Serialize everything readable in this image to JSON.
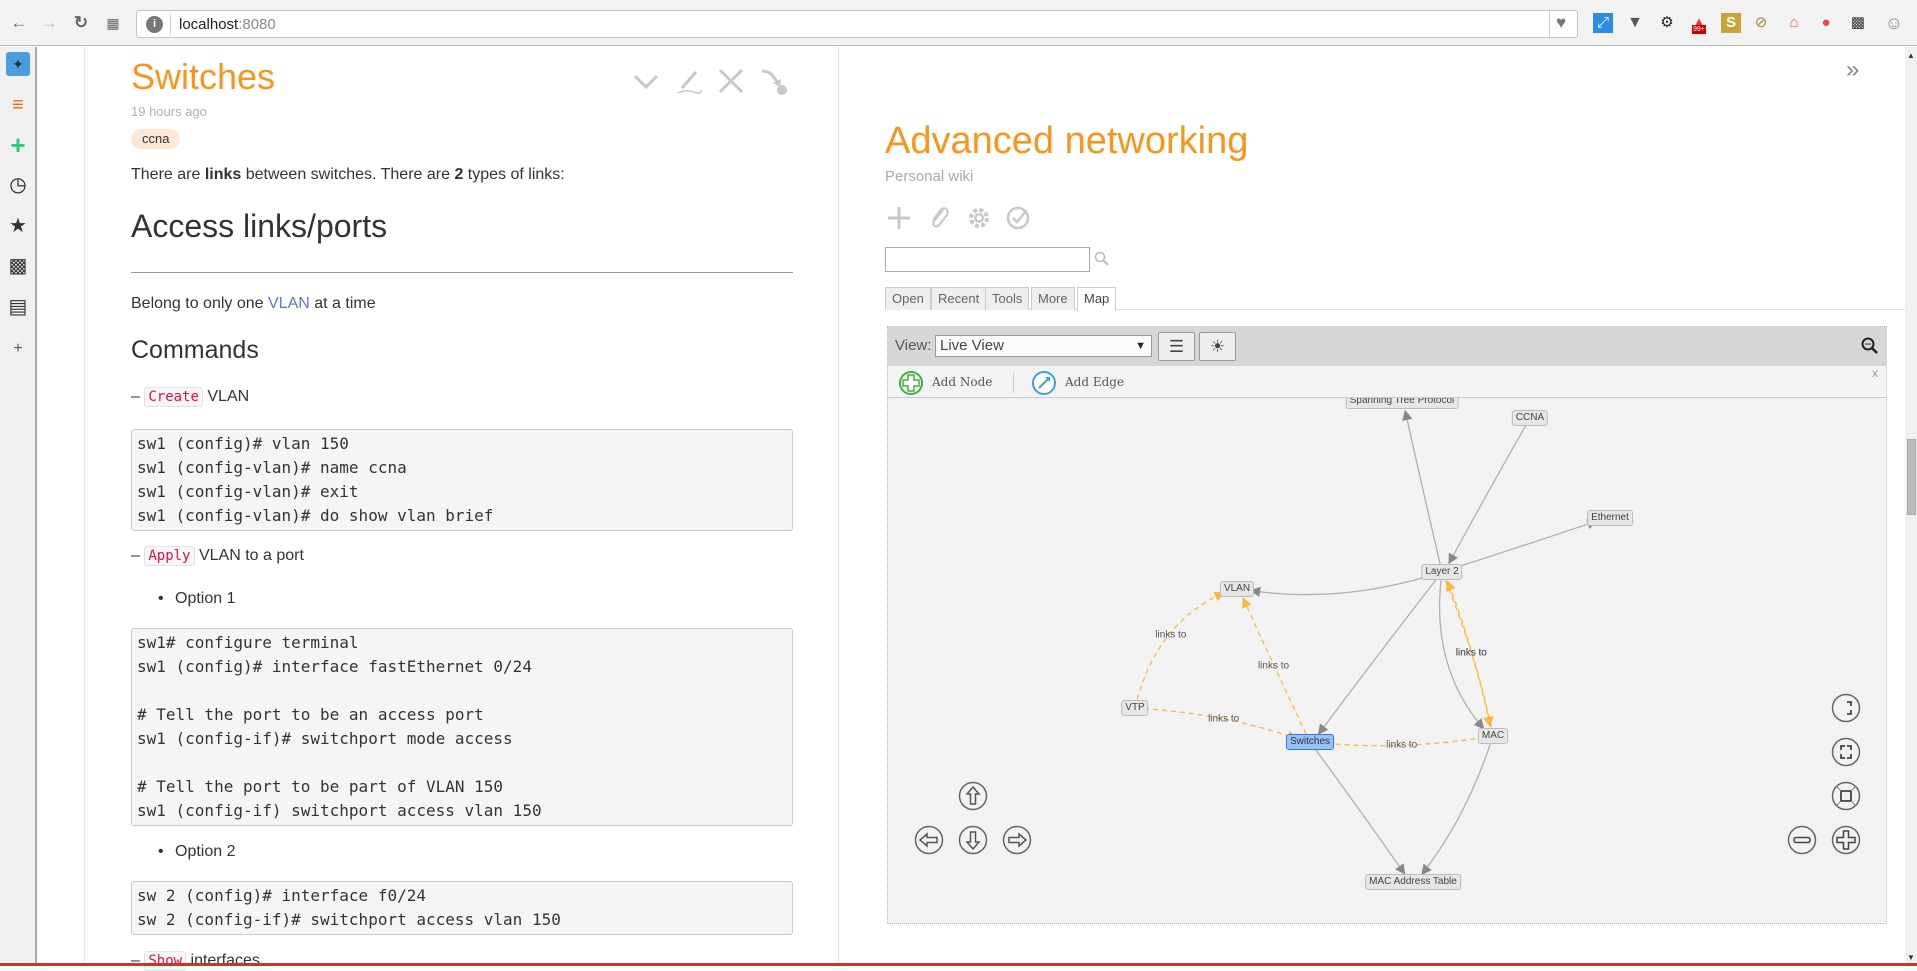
{
  "browser": {
    "url_host": "localhost",
    "url_port": ":8080",
    "extension_icons": [
      "resize-icon",
      "pocket-icon",
      "gear-icon",
      "notification-badge-icon",
      "s-icon",
      "blocked-icon",
      "home-icon",
      "browser-logo-icon",
      "tiles-icon",
      "profile-icon"
    ],
    "badge_text": "99+"
  },
  "sidebar": {
    "icons": [
      "tweetdeck-icon",
      "tasks-icon",
      "add-icon",
      "clock-icon",
      "star-icon",
      "tiles-icon",
      "document-icon",
      "plus-small-icon"
    ]
  },
  "tiddler": {
    "title": "Switches",
    "date": "19 hours ago",
    "tag": "ccna",
    "intro": {
      "t1": "There are ",
      "b1": "links",
      "t2": " between switches. There are ",
      "b2": "2",
      "t3": " types of links:"
    },
    "h_access": "Access links/ports",
    "belong": {
      "t1": "Belong to only one ",
      "link": "VLAN",
      "t2": " at a time"
    },
    "h_commands": "Commands",
    "create_line": {
      "dash": "– ",
      "code": "Create",
      "text": " VLAN"
    },
    "code1": "sw1 (config)# vlan 150\nsw1 (config-vlan)# name ccna\nsw1 (config-vlan)# exit\nsw1 (config-vlan)# do show vlan brief",
    "apply_line": {
      "dash": "– ",
      "code": "Apply",
      "text": " VLAN to a port"
    },
    "option1": "Option 1",
    "code2": "sw1# configure terminal\nsw1 (config)# interface fastEthernet 0/24\n\n# Tell the port to be an access port\nsw1 (config-if)# switchport mode access\n\n# Tell the port to be part of VLAN 150\nsw1 (config-if) switchport access vlan 150",
    "option2": "Option 2",
    "code3": "sw 2 (config)# interface f0/24\nsw 2 (config-if)# switchport access vlan 150",
    "show_line": {
      "dash": "– ",
      "code": "Show",
      "text": " interfaces"
    }
  },
  "site": {
    "title": "Advanced networking",
    "subtitle": "Personal wiki",
    "search_value": "",
    "tabs": [
      "Open",
      "Recent",
      "Tools",
      "More",
      "Map"
    ],
    "active_tab": "Map"
  },
  "map": {
    "view_label": "View:",
    "view_selected": "Live View",
    "add_node": "Add Node",
    "add_edge": "Add Edge",
    "close": "x",
    "nodes": [
      {
        "id": "stp",
        "label": "Spanning Tree Protocol"
      },
      {
        "id": "ccna",
        "label": "CCNA"
      },
      {
        "id": "ethernet",
        "label": "Ethernet"
      },
      {
        "id": "layer2",
        "label": "Layer 2"
      },
      {
        "id": "vlan",
        "label": "VLAN"
      },
      {
        "id": "vtp",
        "label": "VTP"
      },
      {
        "id": "switches",
        "label": "Switches",
        "selected": true
      },
      {
        "id": "mac",
        "label": "MAC"
      },
      {
        "id": "mactable",
        "label": "MAC Address Table"
      }
    ],
    "edges": [
      {
        "from": "layer2",
        "to": "stp",
        "type": "solid"
      },
      {
        "from": "ccna",
        "to": "layer2",
        "type": "solid"
      },
      {
        "from": "layer2",
        "to": "ethernet",
        "type": "solid"
      },
      {
        "from": "layer2",
        "to": "vlan",
        "type": "solid"
      },
      {
        "from": "layer2",
        "to": "switches",
        "type": "solid"
      },
      {
        "from": "layer2",
        "to": "mac",
        "type": "solid"
      },
      {
        "from": "switches",
        "to": "mactable",
        "type": "solid"
      },
      {
        "from": "mac",
        "to": "mactable",
        "type": "solid"
      },
      {
        "from": "vtp",
        "to": "vlan",
        "type": "link",
        "label": "links to"
      },
      {
        "from": "switches",
        "to": "vlan",
        "type": "link",
        "label": "links to"
      },
      {
        "from": "vtp",
        "to": "switches",
        "type": "link",
        "label": "links to"
      },
      {
        "from": "mac",
        "to": "switches",
        "type": "link",
        "label": "links to"
      },
      {
        "from": "mac",
        "to": "layer2",
        "type": "link",
        "label": "links to"
      },
      {
        "from": "layer2",
        "to": "mac",
        "type": "link",
        "label": "links to"
      }
    ],
    "colors": {
      "link_edge": "#ffa500",
      "solid_edge": "#b0b0b0",
      "selected_node": "#97c2fc"
    }
  }
}
